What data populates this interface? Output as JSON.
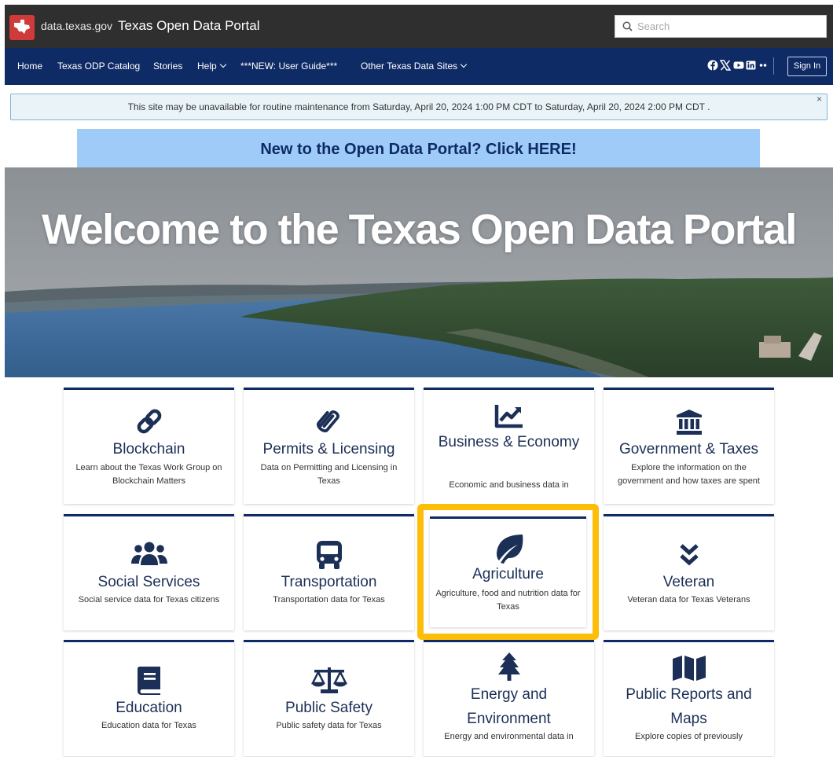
{
  "header": {
    "domain": "data.texas.gov",
    "title": "Texas Open Data Portal",
    "search_placeholder": "Search",
    "logo_icon": "texas-star-logo"
  },
  "nav": {
    "items": [
      {
        "label": "Home",
        "dropdown": false
      },
      {
        "label": "Texas ODP Catalog",
        "dropdown": false
      },
      {
        "label": "Stories",
        "dropdown": false
      },
      {
        "label": "Help",
        "dropdown": true
      },
      {
        "label": "***NEW: User Guide***",
        "dropdown": false
      },
      {
        "label": "Other Texas Data Sites",
        "dropdown": true
      }
    ],
    "social_icons": [
      "facebook-icon",
      "x-icon",
      "youtube-icon",
      "linkedin-icon",
      "more-icon"
    ],
    "signin_label": "Sign In"
  },
  "alert": {
    "message": "This site may be unavailable for routine maintenance from  Saturday, April 20, 2024 1:00 PM CDT  to  Saturday, April 20, 2024 2:00 PM CDT .",
    "close": "×"
  },
  "banner": {
    "label": "New to the Open Data Portal? Click HERE!"
  },
  "hero": {
    "title": "Welcome to the Texas Open Data Portal"
  },
  "categories": [
    {
      "title": "Blockchain",
      "desc": "Learn about the Texas Work Group on Blockchain Matters",
      "icon": "link-icon"
    },
    {
      "title": "Permits & Licensing",
      "desc": "Data on Permitting and Licensing in Texas",
      "icon": "paperclip-icon"
    },
    {
      "title": "Business & Economy",
      "desc": "Economic and business data in",
      "icon": "chart-line-icon"
    },
    {
      "title": "Government & Taxes",
      "desc": "Explore the information on the government and how taxes are spent",
      "icon": "landmark-icon"
    },
    {
      "title": "Social Services",
      "desc": "Social service data for Texas citizens",
      "icon": "users-icon"
    },
    {
      "title": "Transportation",
      "desc": "Transportation data for Texas",
      "icon": "bus-icon"
    },
    {
      "title": "Agriculture",
      "desc": "Agriculture, food and nutrition data for Texas",
      "icon": "leaf-icon"
    },
    {
      "title": "Veteran",
      "desc": "Veteran data for Texas Veterans",
      "icon": "chevron-double-down-icon"
    },
    {
      "title": "Education",
      "desc": "Education data for Texas",
      "icon": "book-icon"
    },
    {
      "title": "Public Safety",
      "desc": "Public safety data for Texas",
      "icon": "balance-scale-icon"
    },
    {
      "title": "Energy and Environment",
      "desc": "Energy and environmental data in",
      "icon": "tree-icon"
    },
    {
      "title": "Public Reports and Maps",
      "desc": "Explore copies of previously",
      "icon": "map-icon"
    }
  ],
  "colors": {
    "navy": "#0f2b65",
    "highlight": "#fdbe0a",
    "banner": "#9ecbf7"
  }
}
